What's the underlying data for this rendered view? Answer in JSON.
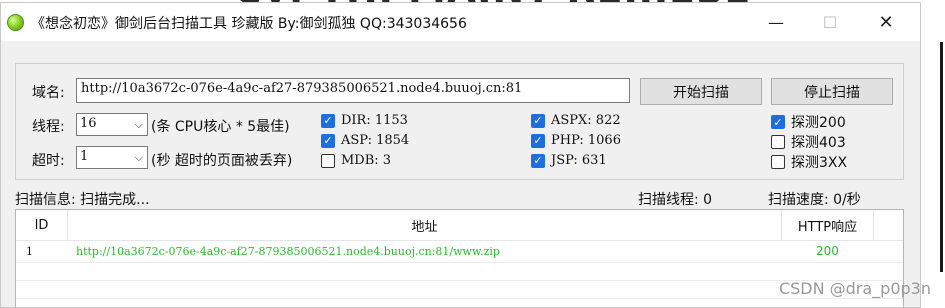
{
  "background_text": "ey: THI MAINT REIIIESE",
  "window": {
    "title": "《想念初恋》御剑后台扫描工具 珍藏版 By:御剑孤独 QQ:343034656",
    "minimize": "—",
    "maximize": "☐",
    "close": "✕"
  },
  "domain": {
    "label": "域名:",
    "value": "http://10a3672c-076e-4a9c-af27-879385006521.node4.buuoj.cn:81"
  },
  "buttons": {
    "start": "开始扫描",
    "stop": "停止扫描"
  },
  "threads": {
    "label": "线程:",
    "value": "16",
    "hint": "(条 CPU核心 * 5最佳)"
  },
  "timeout": {
    "label": "超时:",
    "value": "1",
    "hint": "(秒 超时的页面被丢弃)"
  },
  "dicts": [
    {
      "label": "DIR: 1153",
      "checked": true
    },
    {
      "label": "ASP: 1854",
      "checked": true
    },
    {
      "label": "MDB: 3",
      "checked": false
    },
    {
      "label": "ASPX: 822",
      "checked": true
    },
    {
      "label": "PHP: 1066",
      "checked": true
    },
    {
      "label": "JSP: 631",
      "checked": true
    }
  ],
  "probes": [
    {
      "label": "探测200",
      "checked": true
    },
    {
      "label": "探测403",
      "checked": false
    },
    {
      "label": "探测3XX",
      "checked": false
    }
  ],
  "status": {
    "info": "扫描信息: 扫描完成...",
    "threads": "扫描线程: 0",
    "speed": "扫描速度: 0/秒"
  },
  "table": {
    "headers": [
      "ID",
      "地址",
      "HTTP响应"
    ],
    "rows": [
      {
        "id": "1",
        "url": "http://10a3672c-076e-4a9c-af27-879385006521.node4.buuoj.cn:81/www.zip",
        "code": "200"
      }
    ]
  },
  "watermark": "CSDN @dra_p0p3n",
  "colors": {
    "checkbox": "#1f6ee0",
    "result_text": "#2db82d"
  }
}
